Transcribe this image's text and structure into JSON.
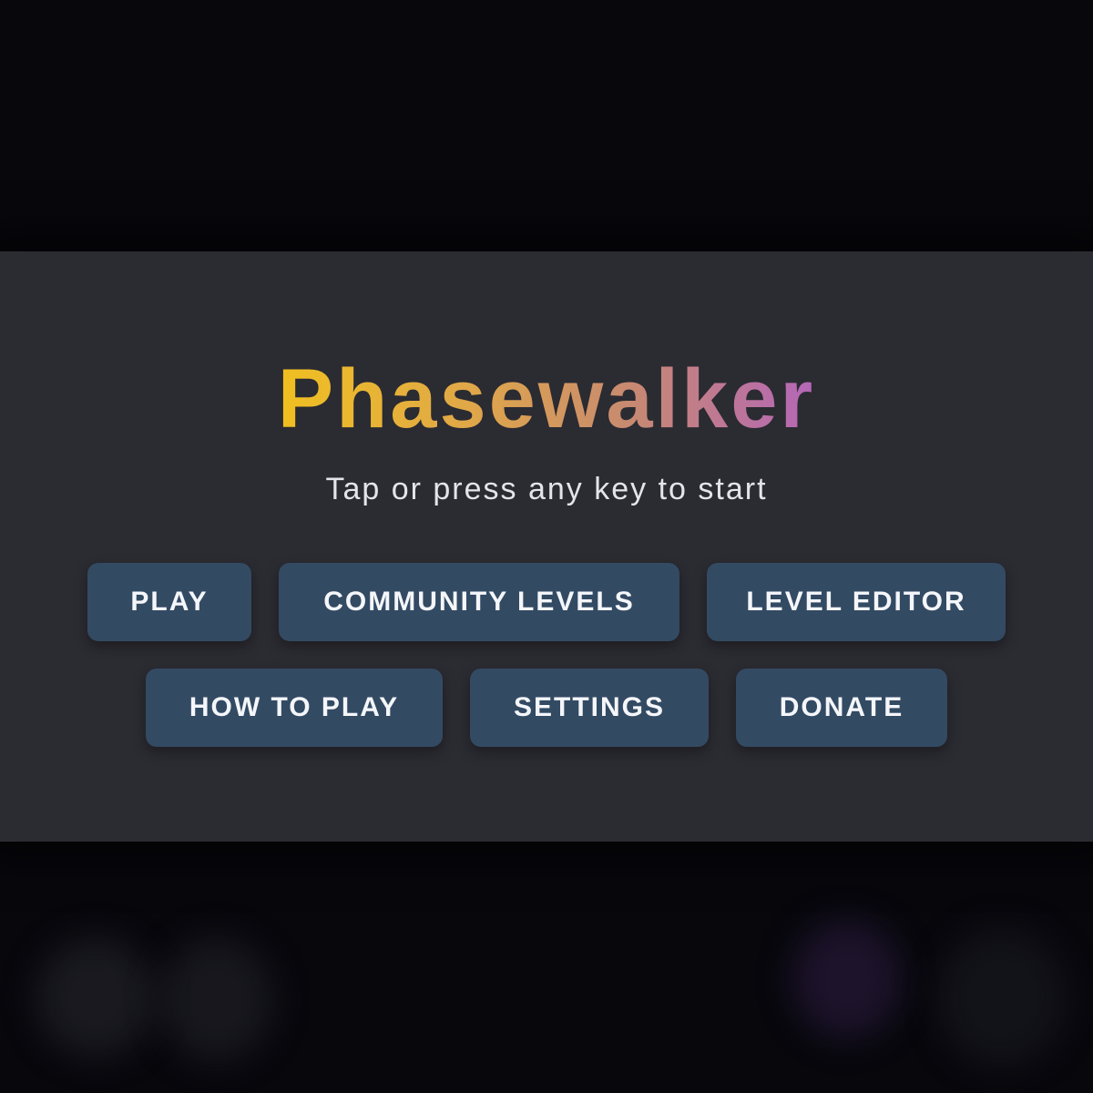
{
  "title": "Phasewalker",
  "subtitle": "Tap or press any key to start",
  "buttons": {
    "play": "PLAY",
    "community_levels": "COMMUNITY LEVELS",
    "level_editor": "LEVEL EDITOR",
    "how_to_play": "HOW TO PLAY",
    "settings": "SETTINGS",
    "donate": "DONATE"
  },
  "colors": {
    "background": "#07070c",
    "panel": "#2b2b32",
    "button": "#334a63",
    "title_gradient_start": "#f0c020",
    "title_gradient_end": "#b466b8"
  }
}
